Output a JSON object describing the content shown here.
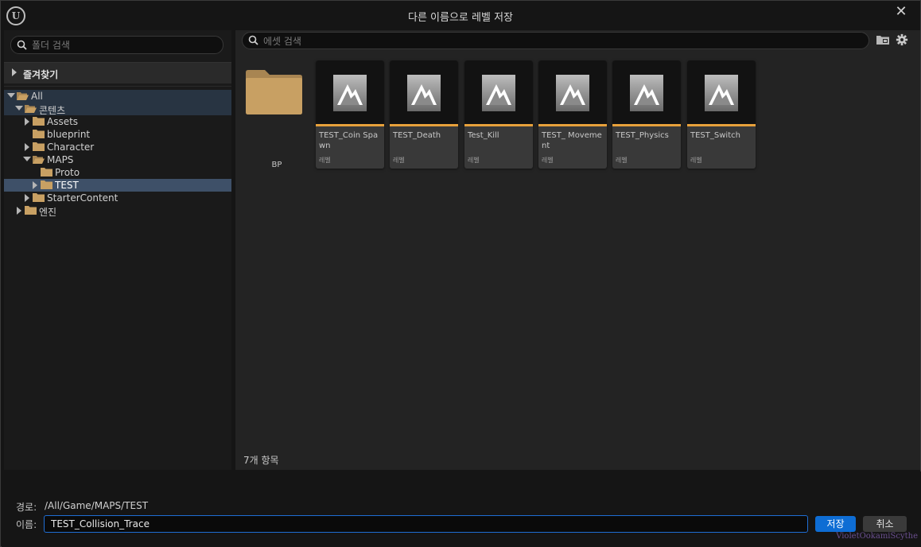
{
  "window": {
    "title": "다른 이름으로 레벨 저장",
    "close_glyph": "✕"
  },
  "left_panel": {
    "search": {
      "placeholder": "폴더 검색",
      "value": ""
    },
    "favorites_label": "즐겨찾기",
    "tree": [
      {
        "label": "All",
        "state": "open"
      },
      {
        "label": "콘텐츠",
        "state": "open"
      },
      {
        "label": "Assets",
        "state": "closed"
      },
      {
        "label": "blueprint",
        "state": "none"
      },
      {
        "label": "Character",
        "state": "closed"
      },
      {
        "label": "MAPS",
        "state": "open"
      },
      {
        "label": "Proto",
        "state": "none"
      },
      {
        "label": "TEST",
        "state": "closed",
        "selected": true
      },
      {
        "label": "StarterContent",
        "state": "closed"
      },
      {
        "label": "엔진",
        "state": "closed"
      }
    ]
  },
  "content": {
    "search": {
      "placeholder": "에셋 검색",
      "value": ""
    },
    "toolbar_icons": [
      "folder-view-icon",
      "settings-gear-icon"
    ],
    "folder": {
      "label": "BP"
    },
    "assets": [
      {
        "name": "TEST_Coin Spawn",
        "type": "레벨"
      },
      {
        "name": "TEST_Death",
        "type": "레벨"
      },
      {
        "name": "Test_Kill",
        "type": "레벨"
      },
      {
        "name": "TEST_ Movement",
        "type": "레벨"
      },
      {
        "name": "TEST_Physics",
        "type": "레벨"
      },
      {
        "name": "TEST_Switch",
        "type": "레벨"
      }
    ],
    "item_count": "7개 항목"
  },
  "footer": {
    "path_label": "경로:",
    "path_value": "/All/Game/MAPS/TEST",
    "name_label": "이름:",
    "name_value": "TEST_Collision_Trace",
    "save_label": "저장",
    "cancel_label": "취소",
    "watermark": "VioletOokamiScythe"
  },
  "colors": {
    "accent": "#0e6dd4",
    "level_bar": "#e8a13b",
    "folder": "#c8a063",
    "selection": "#3e5068"
  }
}
